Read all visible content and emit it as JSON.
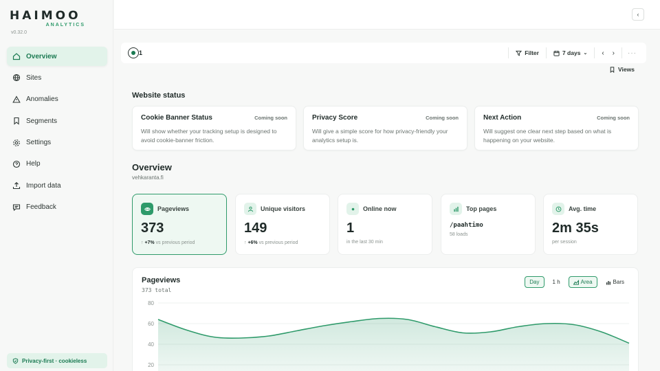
{
  "brand": {
    "name": "HAIMOO",
    "tagline": "ANALYTICS",
    "version": "v0.32.0"
  },
  "sidebar": {
    "items": [
      {
        "label": "Overview",
        "icon": "home-icon",
        "active": true
      },
      {
        "label": "Sites",
        "icon": "globe-icon"
      },
      {
        "label": "Anomalies",
        "icon": "warning-icon"
      },
      {
        "label": "Segments",
        "icon": "bookmark-icon"
      },
      {
        "label": "Settings",
        "icon": "gear-icon"
      },
      {
        "label": "Help",
        "icon": "help-circle-icon"
      },
      {
        "label": "Import data",
        "icon": "upload-icon"
      },
      {
        "label": "Feedback",
        "icon": "chat-icon"
      }
    ],
    "badge": "Privacy-first · cookieless"
  },
  "toolbar": {
    "live_count": "1",
    "filter_label": "Filter",
    "range_label": "7 days",
    "prev": "‹",
    "next": "›",
    "more": "···",
    "views_label": "Views"
  },
  "website_status": {
    "title": "Website status",
    "cards": [
      {
        "title": "Cookie Banner Status",
        "badge": "Coming soon",
        "desc": "Will show whether your tracking setup is designed to avoid cookie-banner friction."
      },
      {
        "title": "Privacy Score",
        "badge": "Coming soon",
        "desc": "Will give a simple score for how privacy-friendly your analytics setup is."
      },
      {
        "title": "Next Action",
        "badge": "Coming soon",
        "desc": "Will suggest one clear next step based on what is happening on your website."
      }
    ]
  },
  "overview": {
    "title": "Overview",
    "domain": "vehkaranta.fi",
    "stats": {
      "pageviews": {
        "label": "Pageviews",
        "value": "373",
        "change": "+7%",
        "change_text": "vs previous period"
      },
      "visitors": {
        "label": "Unique visitors",
        "value": "149",
        "change": "+6%",
        "change_text": "vs previous period"
      },
      "online": {
        "label": "Online now",
        "value": "1",
        "sub": "in the last 30 min"
      },
      "top_pages": {
        "label": "Top pages",
        "value": "/paahtimo",
        "sub": "58 loads"
      },
      "avg_time": {
        "label": "Avg. time",
        "value": "2m 35s",
        "sub": "per session"
      }
    }
  },
  "chart": {
    "title": "Pageviews",
    "total": "373 total",
    "controls": {
      "day": "Day",
      "hour": "1 h",
      "area": "Area",
      "bars": "Bars"
    },
    "accent": "#2e9a6a"
  },
  "chart_data": {
    "type": "area",
    "series": [
      {
        "values": [
          64,
          54,
          47,
          46,
          48,
          53,
          58,
          62,
          65,
          64,
          57,
          51,
          52,
          57,
          60,
          59,
          52,
          41
        ]
      }
    ],
    "ylim": [
      0,
      80
    ],
    "yticks": [
      20,
      40,
      60,
      80
    ]
  }
}
